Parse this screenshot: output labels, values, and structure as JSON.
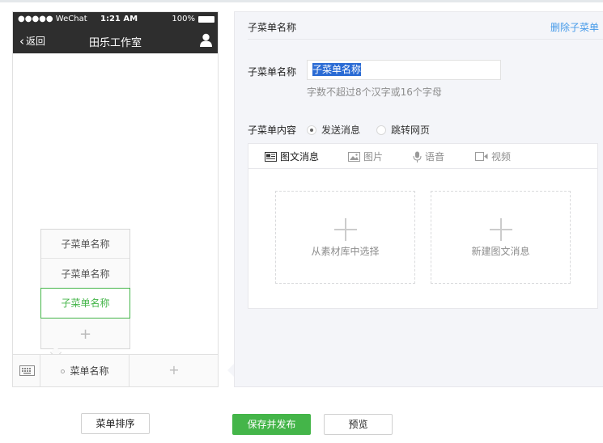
{
  "phone": {
    "status_bar": {
      "carrier": "●●●●● WeChat",
      "time": "1:21 AM",
      "battery": "100%"
    },
    "nav": {
      "back_label": "返回",
      "title": "田乐工作室"
    },
    "submenu_items": [
      "子菜单名称",
      "子菜单名称",
      "子菜单名称"
    ],
    "submenu_add": "+",
    "menu_label": "菜单名称",
    "menu_add": "+"
  },
  "editor": {
    "header_title": "子菜单名称",
    "delete_label": "删除子菜单",
    "name_label": "子菜单名称",
    "name_value": "子菜单名称",
    "name_hint": "字数不超过8个汉字或16个字母",
    "content_label": "子菜单内容",
    "content_options": [
      {
        "label": "发送消息",
        "checked": true
      },
      {
        "label": "跳转网页",
        "checked": false
      }
    ],
    "tabs": [
      {
        "label": "图文消息",
        "icon": "news-icon",
        "active": true
      },
      {
        "label": "图片",
        "icon": "image-icon",
        "active": false
      },
      {
        "label": "语音",
        "icon": "microphone-icon",
        "active": false
      },
      {
        "label": "视频",
        "icon": "video-icon",
        "active": false
      }
    ],
    "cards": [
      {
        "label": "从素材库中选择",
        "icon": "plus-icon"
      },
      {
        "label": "新建图文消息",
        "icon": "plus-icon"
      }
    ]
  },
  "footer": {
    "sort_label": "菜单排序",
    "save_publish_label": "保存并发布",
    "preview_label": "预览"
  },
  "colors": {
    "accent": "#44b549",
    "link": "#459ae9",
    "nav_bg": "#2e2e2e",
    "editor_bg": "#f4f5f9"
  }
}
